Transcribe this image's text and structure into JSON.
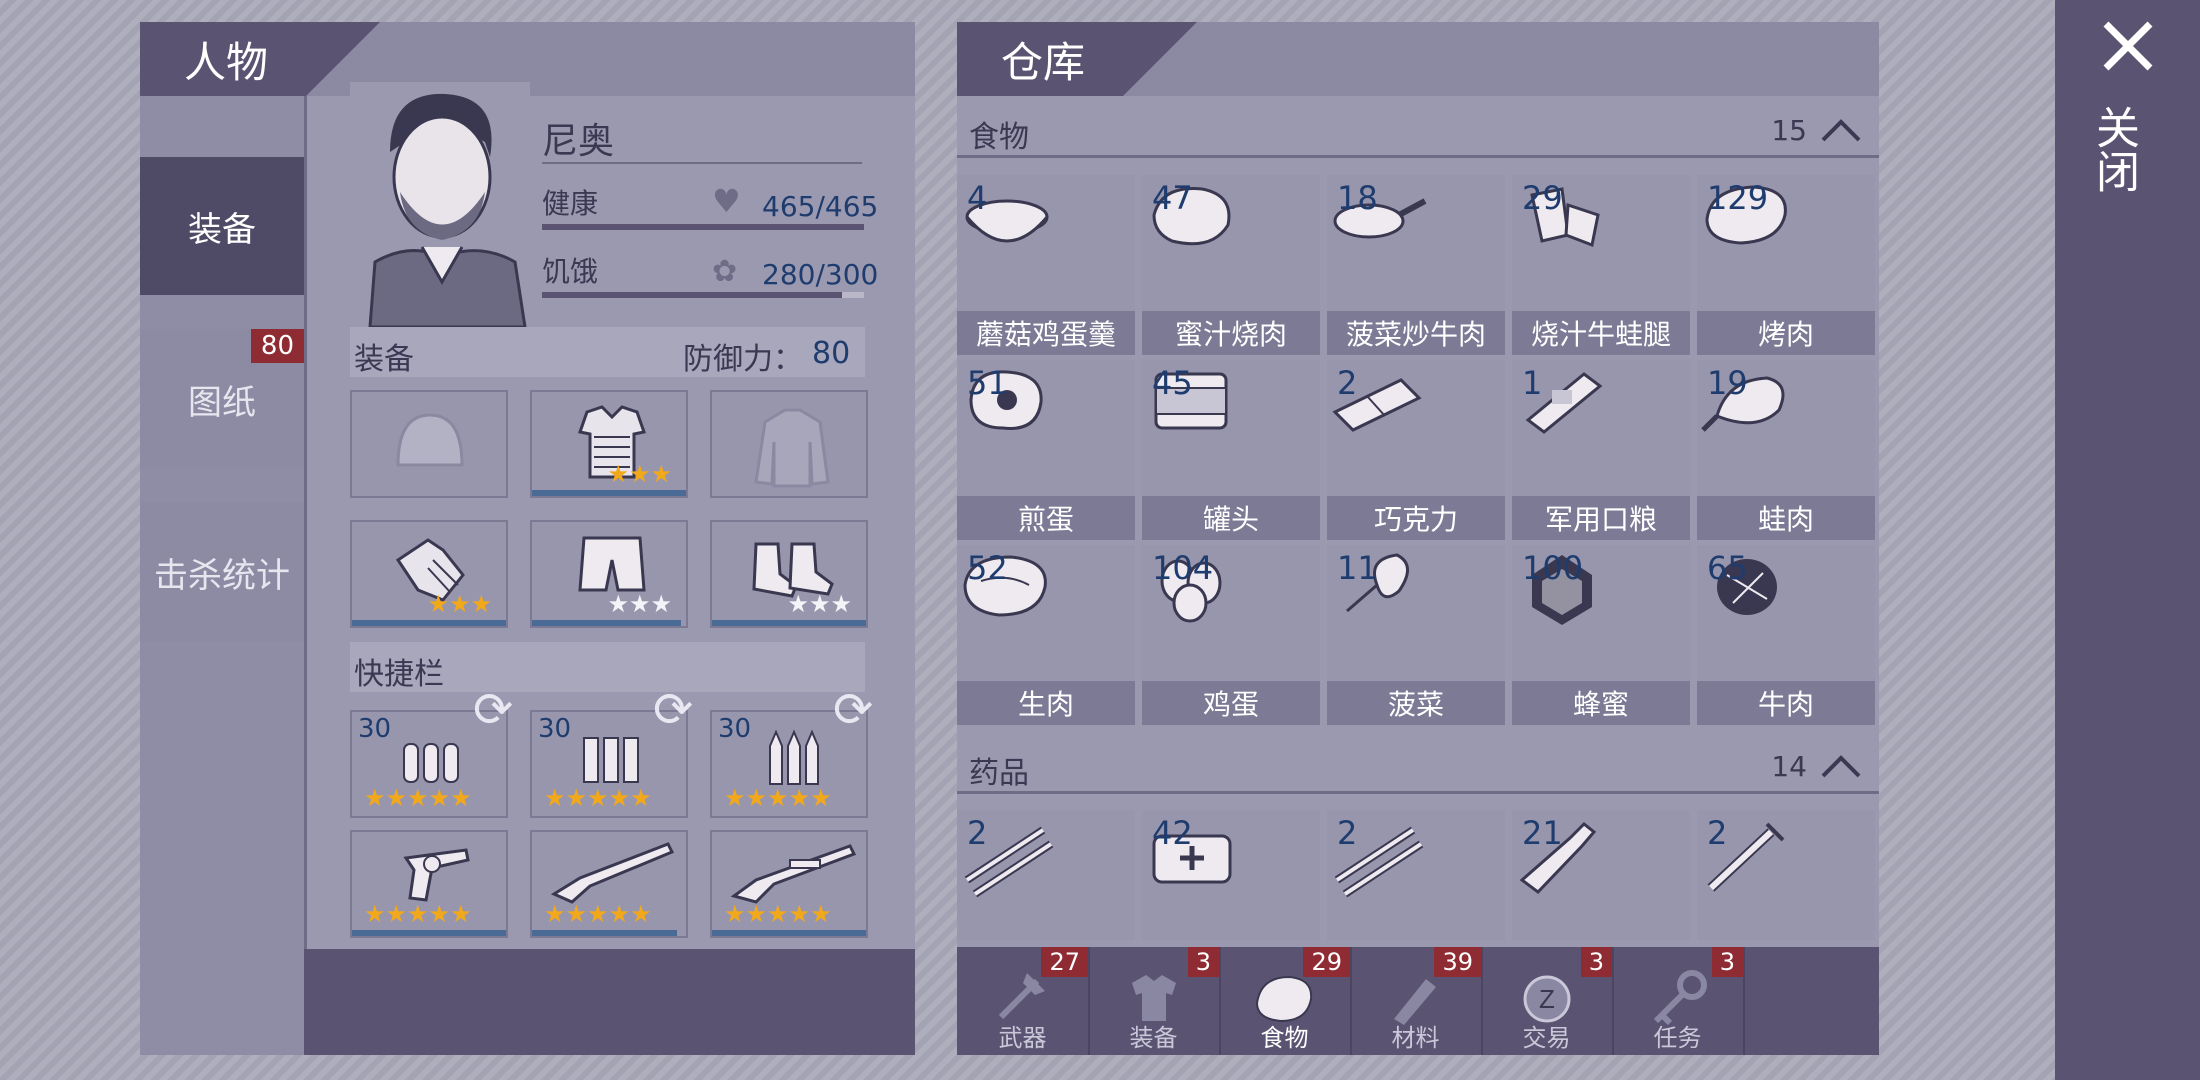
{
  "character_panel": {
    "title": "人物",
    "tabs": [
      {
        "label": "装备",
        "active": true
      },
      {
        "label": "图纸",
        "badge": "80"
      },
      {
        "label": "击杀统计"
      }
    ],
    "name": "尼奥",
    "health_label": "健康",
    "health_value": "465/465",
    "health_fraction": 1.0,
    "hunger_label": "饥饿",
    "hunger_value": "280/300",
    "hunger_fraction": 0.933,
    "equipment_label": "装备",
    "defense_label": "防御力：",
    "defense_value": "80",
    "equipment_slots": [
      {
        "icon": "helmet-icon",
        "stars": 0,
        "filled": false
      },
      {
        "icon": "body-armor-icon",
        "stars": 3,
        "star_color": "gold",
        "durability": 1.0
      },
      {
        "icon": "jacket-icon",
        "stars": 0,
        "filled": false
      },
      {
        "icon": "gloves-icon",
        "stars": 3,
        "star_color": "gold",
        "durability": 1.0
      },
      {
        "icon": "pants-icon",
        "stars": 3,
        "star_color": "silver",
        "durability": 0.97
      },
      {
        "icon": "shoes-icon",
        "stars": 3,
        "star_color": "silver",
        "durability": 1.0
      }
    ],
    "quickbar_label": "快捷栏",
    "ammo_slots": [
      {
        "count": "30",
        "icon": "pistol-ammo-icon",
        "stars": 5
      },
      {
        "count": "30",
        "icon": "shotgun-shells-icon",
        "stars": 5
      },
      {
        "count": "30",
        "icon": "rifle-ammo-icon",
        "stars": 5
      }
    ],
    "weapon_slots": [
      {
        "icon": "revolver-icon",
        "stars": 5,
        "durability": 1.0
      },
      {
        "icon": "shotgun-icon",
        "stars": 5,
        "durability": 0.94
      },
      {
        "icon": "rifle-icon",
        "stars": 5,
        "durability": 1.0
      }
    ]
  },
  "warehouse": {
    "title": "仓库",
    "close_label": "关闭",
    "food_section": {
      "label": "食物",
      "count": "15",
      "items": [
        {
          "count": "4",
          "name": "蘑菇鸡蛋羹",
          "icon": "bowl-icon"
        },
        {
          "count": "47",
          "name": "蜜汁烧肉",
          "icon": "roast-meat-icon"
        },
        {
          "count": "18",
          "name": "菠菜炒牛肉",
          "icon": "pan-icon"
        },
        {
          "count": "29",
          "name": "烧汁牛蛙腿",
          "icon": "frog-legs-icon"
        },
        {
          "count": "129",
          "name": "烤肉",
          "icon": "steak-icon"
        },
        {
          "count": "51",
          "name": "煎蛋",
          "icon": "fried-egg-icon"
        },
        {
          "count": "45",
          "name": "罐头",
          "icon": "can-icon"
        },
        {
          "count": "2",
          "name": "巧克力",
          "icon": "chocolate-icon"
        },
        {
          "count": "1",
          "name": "军用口粮",
          "icon": "ration-icon"
        },
        {
          "count": "19",
          "name": "蛙肉",
          "icon": "frog-meat-icon"
        },
        {
          "count": "52",
          "name": "生肉",
          "icon": "raw-meat-icon"
        },
        {
          "count": "104",
          "name": "鸡蛋",
          "icon": "eggs-icon"
        },
        {
          "count": "11",
          "name": "菠菜",
          "icon": "spinach-icon"
        },
        {
          "count": "100",
          "name": "蜂蜜",
          "icon": "honeycomb-icon"
        },
        {
          "count": "65",
          "name": "牛肉",
          "icon": "beef-icon"
        }
      ]
    },
    "medicine_section": {
      "label": "药品",
      "count": "14",
      "items": [
        {
          "count": "2",
          "icon": "splint-icon"
        },
        {
          "count": "42",
          "icon": "medkit-icon"
        },
        {
          "count": "2",
          "icon": "splint-icon"
        },
        {
          "count": "21",
          "icon": "bottle-icon"
        },
        {
          "count": "2",
          "icon": "syringe-icon"
        }
      ]
    },
    "dock": [
      {
        "label": "武器",
        "badge": "27",
        "icon": "axe-icon"
      },
      {
        "label": "装备",
        "badge": "3",
        "icon": "shirt-icon"
      },
      {
        "label": "食物",
        "badge": "29",
        "icon": "meat-icon",
        "active": true
      },
      {
        "label": "材料",
        "badge": "39",
        "icon": "material-icon"
      },
      {
        "label": "交易",
        "badge": "3",
        "icon": "coin-icon"
      },
      {
        "label": "任务",
        "badge": "3",
        "icon": "key-icon"
      }
    ]
  },
  "colors": {
    "accent": "#5a5472",
    "count_text": "#1e3c6e",
    "badge": "#8f2c33",
    "bar": "#4a6b96"
  }
}
